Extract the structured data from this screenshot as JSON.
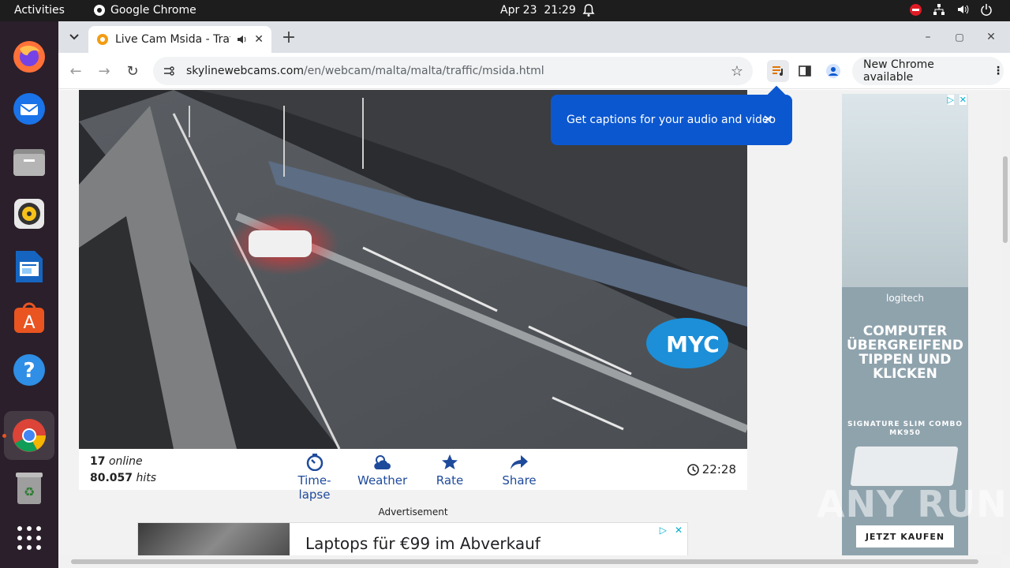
{
  "system": {
    "activities": "Activities",
    "app_name": "Google Chrome",
    "date": "Apr 23",
    "time": "21:29"
  },
  "browser": {
    "tab_title": "Live Cam Msida - Traffic",
    "url_host": "skylinewebcams.com",
    "url_path": "/en/webcam/malta/malta/traffic/msida.html",
    "new_chrome": "New Chrome available",
    "captions_tooltip": "Get captions for your audio and video"
  },
  "webcam": {
    "online_count": "17",
    "online_label": "online",
    "hits_count": "80.057",
    "hits_label": "hits",
    "actions": [
      {
        "label": "Time-lapse",
        "icon": "timelapse-icon"
      },
      {
        "label": "Weather",
        "icon": "weather-icon"
      },
      {
        "label": "Rate",
        "icon": "star-icon"
      },
      {
        "label": "Share",
        "icon": "share-icon"
      }
    ],
    "clock": "22:28",
    "overlay_logo": "MYC"
  },
  "ads": {
    "label": "Advertisement",
    "banner_text": "Laptops für €99 im Abverkauf",
    "side_brand": "logitech",
    "side_headline": "COMPUTER ÜBERGREIFEND TIPPEN UND KLICKEN",
    "side_product": "SIGNATURE SLIM COMBO MK950",
    "side_cta": "JETZT KAUFEN"
  },
  "watermark": "ANY RUN",
  "colors": {
    "accent": "#1e4a9c",
    "tooltip": "#0b57d0",
    "ubuntu_orange": "#e95420"
  }
}
